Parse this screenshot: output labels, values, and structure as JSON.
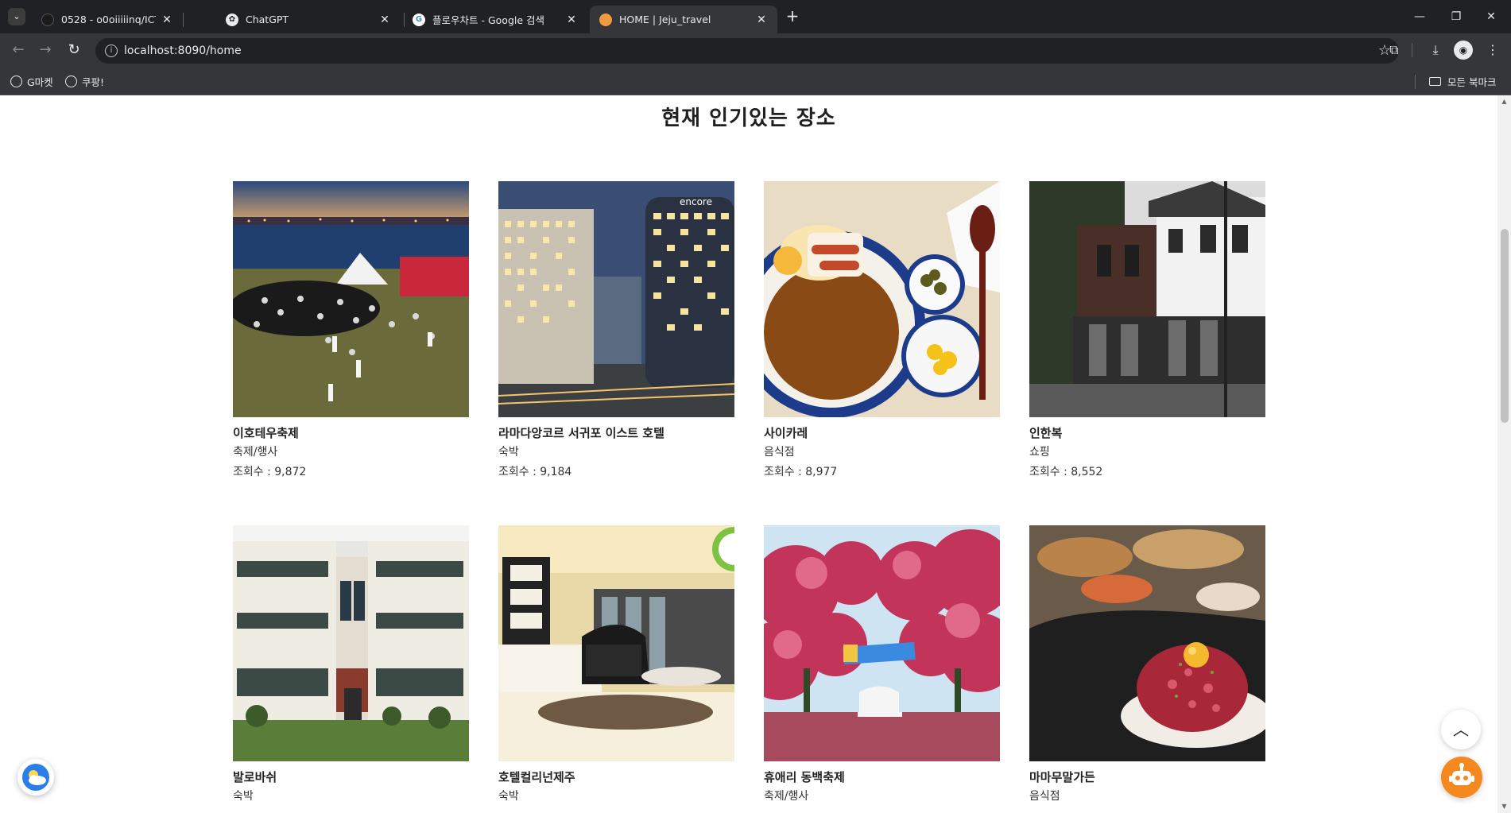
{
  "browser": {
    "tabs": [
      {
        "title": "0528 - o0oiiiiinq/ICT_project02",
        "favicon": "github-icon"
      },
      {
        "title": "ChatGPT",
        "favicon": "chatgpt-icon"
      },
      {
        "title": "플로우차트 - Google 검색",
        "favicon": "google-icon"
      },
      {
        "title": "HOME | Jeju_travel",
        "favicon": "jeju-icon",
        "active": true
      }
    ],
    "url": "localhost:8090/home",
    "bookmarks": [
      {
        "label": "G마켓"
      },
      {
        "label": "쿠팡!"
      }
    ],
    "all_bookmarks_label": "모든 북마크"
  },
  "page": {
    "section_title": "현재 인기있는 장소",
    "places": [
      {
        "name": "이호테우축제",
        "category": "축제/행사",
        "views": "조회수 : 9,872",
        "image": "festival-night-beach"
      },
      {
        "name": "라마다앙코르 서귀포 이스트 호텔",
        "category": "숙박",
        "views": "조회수 : 9,184",
        "image": "hotel-tower-night"
      },
      {
        "name": "사이카레",
        "category": "음식점",
        "views": "조회수 : 8,977",
        "image": "curry-plate"
      },
      {
        "name": "인한복",
        "category": "쇼핑",
        "views": "조회수 : 8,552",
        "image": "brick-house"
      },
      {
        "name": "발로바쉬",
        "category": "숙박",
        "views": "",
        "image": "white-villa"
      },
      {
        "name": "호텔컬리넌제주",
        "category": "숙박",
        "views": "",
        "image": "hotel-room"
      },
      {
        "name": "휴애리 동백축제",
        "category": "축제/행사",
        "views": "",
        "image": "camellia-garden"
      },
      {
        "name": "마마무말가든",
        "category": "음식점",
        "views": "",
        "image": "beef-tartare"
      }
    ],
    "colors": {
      "accent_orange": "#f5891f",
      "weather_blue": "#1e88e5"
    }
  }
}
